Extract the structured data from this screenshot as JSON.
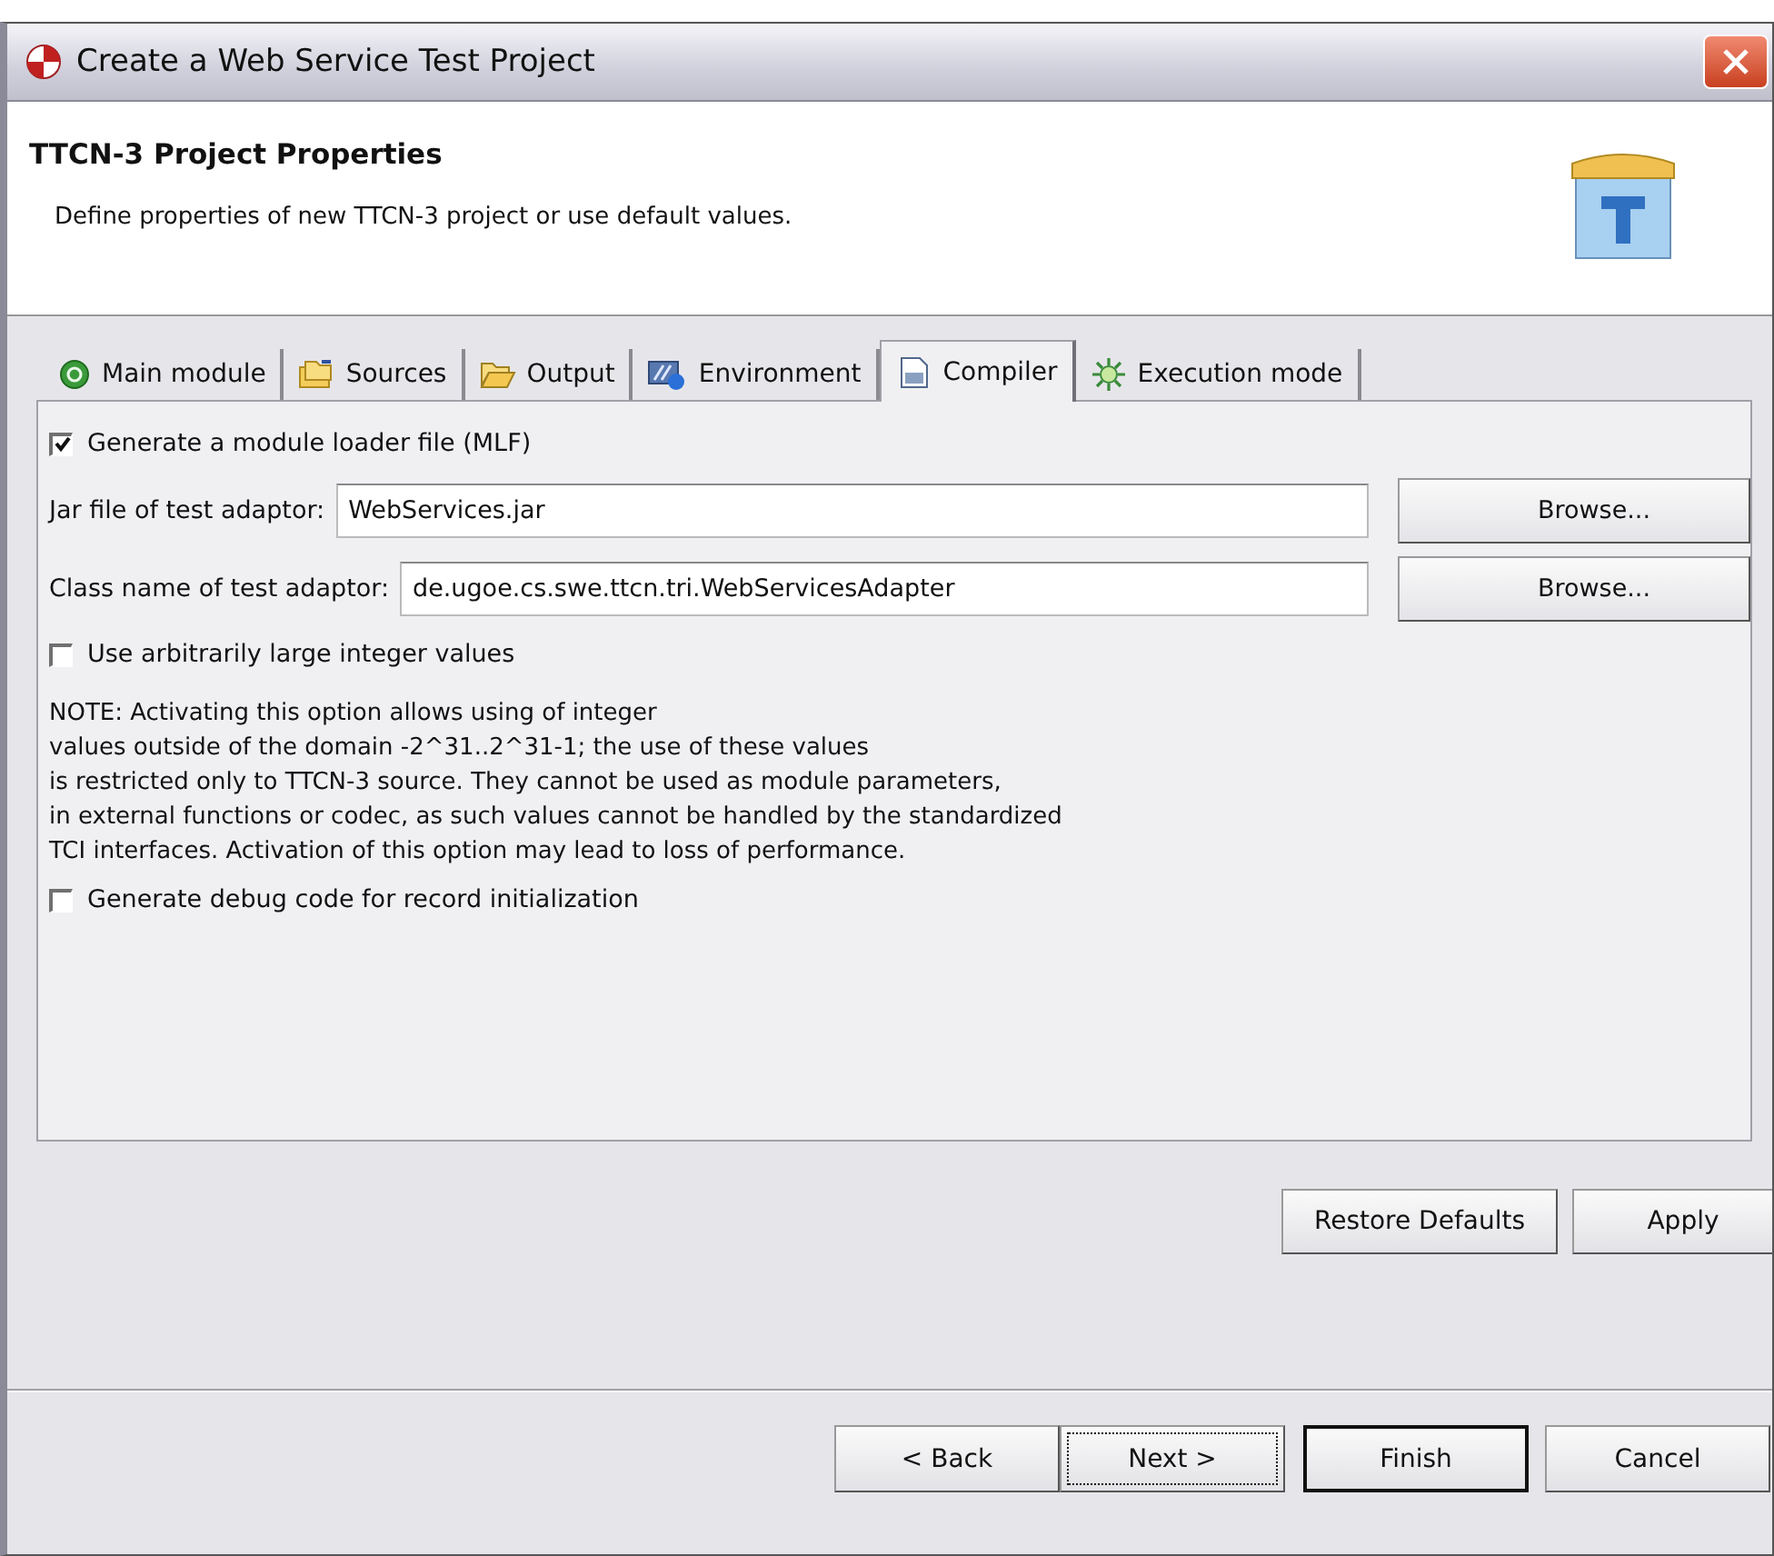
{
  "window": {
    "title": "Create a Web Service Test Project"
  },
  "header": {
    "title": "TTCN-3 Project Properties",
    "description": "Define properties of new TTCN-3 project or use default values."
  },
  "tabs": [
    {
      "label": "Main module",
      "kind": "module",
      "selected": false
    },
    {
      "label": "Sources",
      "kind": "sources",
      "selected": false
    },
    {
      "label": "Output",
      "kind": "output",
      "selected": false
    },
    {
      "label": "Environment",
      "kind": "environment",
      "selected": false
    },
    {
      "label": "Compiler",
      "kind": "compiler",
      "selected": true
    },
    {
      "label": "Execution mode",
      "kind": "execution",
      "selected": false
    }
  ],
  "controls": [
    {
      "kind": "checkbox",
      "label": "Generate a module loader file (MLF)",
      "checked": true
    },
    {
      "kind": "field",
      "label": "Jar file of test adaptor:",
      "value": "WebServices.jar",
      "button": "Browse..."
    },
    {
      "kind": "field",
      "label": "Class name of test adaptor:",
      "value": "de.ugoe.cs.swe.ttcn.tri.WebServicesAdapter",
      "button": "Browse..."
    },
    {
      "kind": "checkbox",
      "label": "Use arbitrarily large integer values",
      "checked": false
    },
    {
      "kind": "note",
      "lines": [
        "NOTE: Activating this option allows using of integer",
        "values outside of the domain -2^31..2^31-1; the use of these values",
        "is restricted only to TTCN-3 source. They cannot be used as module parameters,",
        "in external functions or codec, as such values cannot be handled by the standardized",
        "TCI interfaces. Activation of this option may lead to loss of performance."
      ]
    },
    {
      "kind": "checkbox",
      "label": "Generate debug code for record initialization",
      "checked": false
    }
  ],
  "page_buttons": [
    "Restore Defaults",
    "Apply"
  ],
  "buttons": [
    {
      "label": "< Back",
      "focused": false,
      "default": false
    },
    {
      "label": "Next >",
      "focused": true,
      "default": false
    },
    {
      "label": "Finish",
      "focused": false,
      "default": true
    },
    {
      "label": "Cancel",
      "focused": false,
      "default": false
    }
  ]
}
